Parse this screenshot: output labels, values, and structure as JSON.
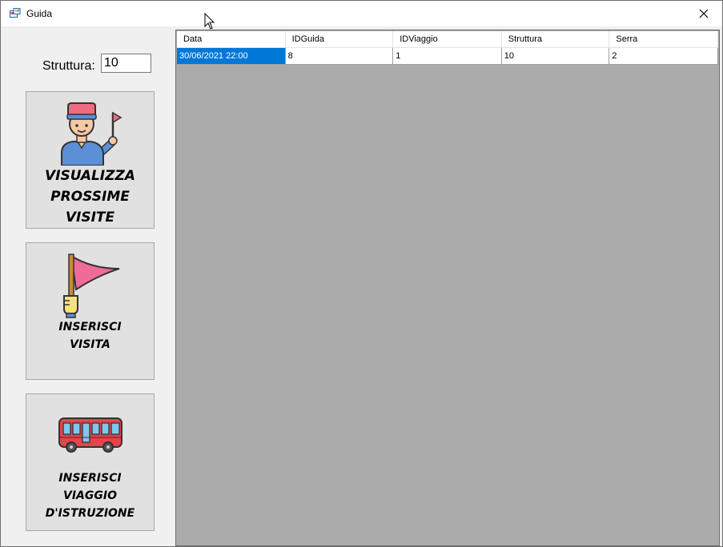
{
  "window": {
    "title": "Guida",
    "close_label": "✕"
  },
  "form": {
    "struttura_label": "Struttura:",
    "struttura_value": "10"
  },
  "buttons": {
    "visualizza": "VISUALIZZA\nPROSSIME\nVISITE",
    "inserisci_visita": "INSERISCI\nVISITA",
    "inserisci_viaggio": "INSERISCI\nVIAGGIO\nD'ISTRUZIONE"
  },
  "icons": {
    "visualizza": "tour-guide-icon",
    "inserisci_visita": "pennant-flag-icon",
    "inserisci_viaggio": "bus-icon"
  },
  "grid": {
    "columns": [
      "Data",
      "IDGuida",
      "IDViaggio",
      "Struttura",
      "Serra"
    ],
    "rows": [
      [
        "30/06/2021 22:00",
        "8",
        "1",
        "10",
        "2"
      ]
    ],
    "selected_row": 0,
    "selected_col": 0
  },
  "colors": {
    "selection": "#0078d7",
    "grid_background": "#ababab",
    "window_background": "#f0f0f0"
  }
}
